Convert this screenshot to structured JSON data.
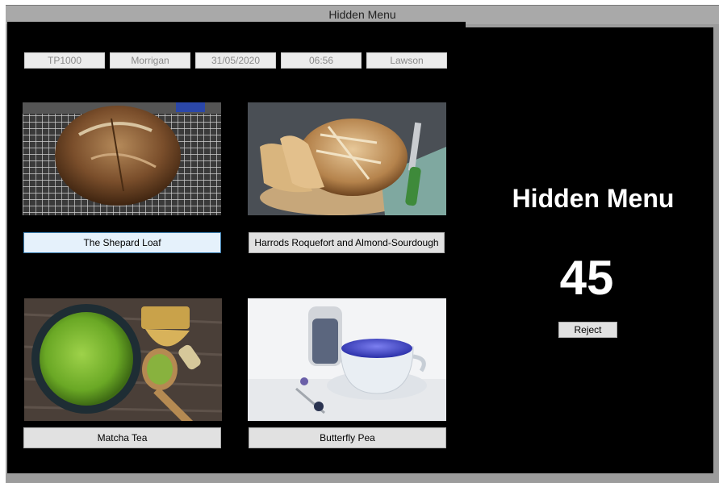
{
  "window": {
    "title": "Hidden Menu"
  },
  "fields": [
    "TP1000",
    "Morrigan",
    "31/05/2020",
    "06:56",
    "Lawson"
  ],
  "menu_items": [
    {
      "label": "The Shepard Loaf",
      "image": "sourdough-loaf-on-rack"
    },
    {
      "label": "Harrods Roquefort and Almond-Sourdough",
      "image": "sliced-sourdough-on-board"
    },
    {
      "label": "Matcha Tea",
      "image": "matcha-bowl-with-whisk"
    },
    {
      "label": "Butterfly Pea",
      "image": "blue-tea-cup"
    }
  ],
  "panel": {
    "heading": "Hidden Menu",
    "count": "45",
    "reject_label": "Reject"
  }
}
